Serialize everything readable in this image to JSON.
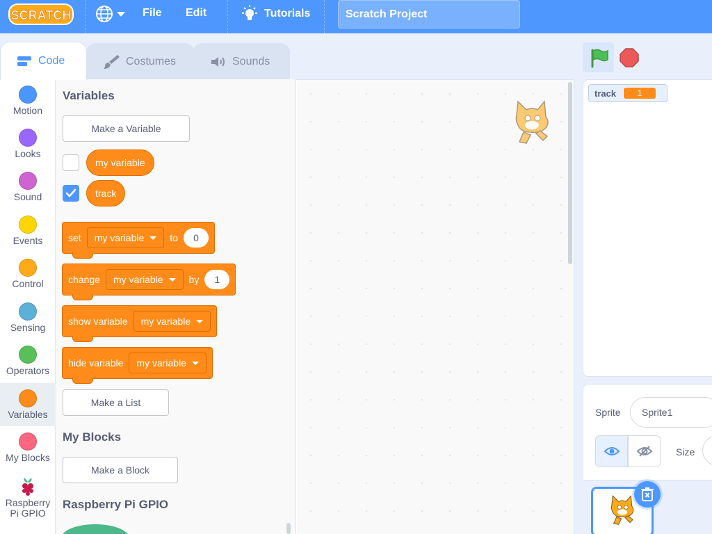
{
  "menubar": {
    "logo_text": "SCRATCH",
    "file_label": "File",
    "edit_label": "Edit",
    "tutorials_label": "Tutorials",
    "project_title": "Scratch Project",
    "accent_color": "#4d97ff"
  },
  "tabs": {
    "code": "Code",
    "costumes": "Costumes",
    "sounds": "Sounds"
  },
  "categories": [
    {
      "label": "Motion",
      "color": "#4c97ff"
    },
    {
      "label": "Looks",
      "color": "#9966ff"
    },
    {
      "label": "Sound",
      "color": "#cf63cf"
    },
    {
      "label": "Events",
      "color": "#ffd500"
    },
    {
      "label": "Control",
      "color": "#ffab19"
    },
    {
      "label": "Sensing",
      "color": "#5cb1d6"
    },
    {
      "label": "Operators",
      "color": "#59c059"
    },
    {
      "label": "Variables",
      "color": "#ff8c1a"
    },
    {
      "label": "My Blocks",
      "color": "#ff6680"
    },
    {
      "label": "Raspberry Pi GPIO",
      "color": "#c51a4a"
    }
  ],
  "palette": {
    "variables_title": "Variables",
    "make_variable": "Make a Variable",
    "var1": "my variable",
    "var1_checked": false,
    "var2": "track",
    "var2_checked": true,
    "set_block": {
      "prefix": "set",
      "dropdown": "my variable",
      "mid": "to",
      "value": "0"
    },
    "change_block": {
      "prefix": "change",
      "dropdown": "my variable",
      "mid": "by",
      "value": "1"
    },
    "show_block": {
      "prefix": "show variable",
      "dropdown": "my variable"
    },
    "hide_block": {
      "prefix": "hide variable",
      "dropdown": "my variable"
    },
    "make_list": "Make a List",
    "myblocks_title": "My Blocks",
    "make_block": "Make a Block",
    "gpio_title": "Raspberry Pi GPIO"
  },
  "stage": {
    "monitor_name": "track",
    "monitor_value": "1"
  },
  "sprite_pane": {
    "sprite_label": "Sprite",
    "sprite_name": "Sprite1",
    "size_label": "Size",
    "show_icon": "eye-icon",
    "hide_icon": "eye-slash-icon"
  }
}
